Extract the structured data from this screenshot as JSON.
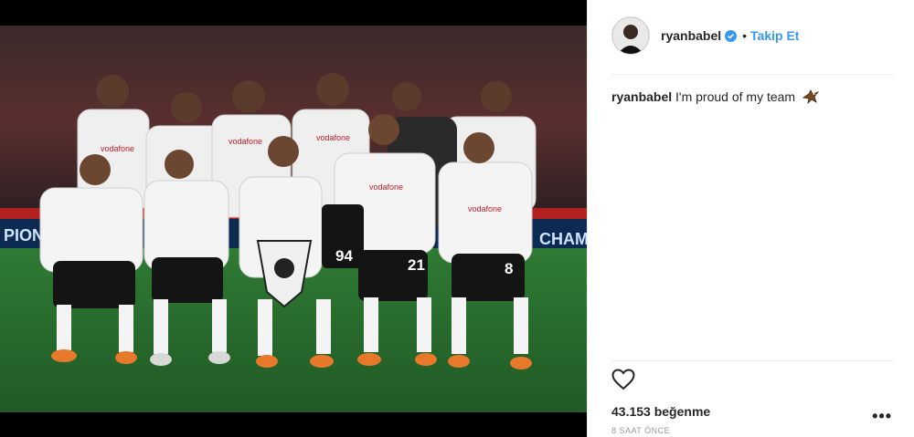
{
  "post": {
    "image_alt": "Beşiktaş team photo",
    "header": {
      "username": "ryanbabel",
      "verified_icon": "verified-badge-icon",
      "separator": "•",
      "follow_label": "Takip Et"
    },
    "caption": {
      "username": "ryanbabel",
      "text": "I'm proud of my team",
      "emoji_icon": "eagle-emoji-icon"
    },
    "actions": {
      "like_icon": "heart-outline-icon",
      "more_icon": "more-options-icon",
      "more_label": "•••"
    },
    "likes_text": "43.153 beğenme",
    "timestamp": "8 SAAT ÖNCE"
  },
  "photo_text": {
    "ad_board_left": "PIONS",
    "ad_board_right": "CHAM",
    "sponsor": "vodafone",
    "numbers": [
      "94",
      "21",
      "8"
    ]
  },
  "colors": {
    "accent_blue": "#3897f0",
    "text_dark": "#262626",
    "text_muted": "#999999"
  }
}
